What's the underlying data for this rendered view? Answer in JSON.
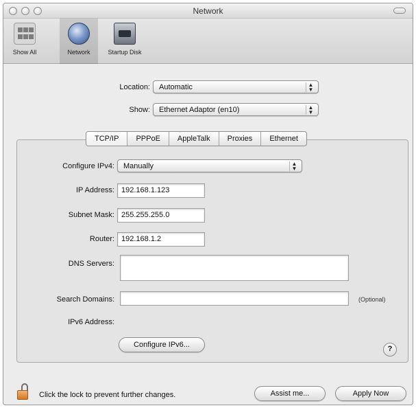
{
  "window": {
    "title": "Network"
  },
  "toolbar": {
    "items": [
      {
        "label": "Show All",
        "icon": "show-all-icon"
      },
      {
        "label": "Network",
        "icon": "network-globe-icon",
        "selected": true
      },
      {
        "label": "Startup Disk",
        "icon": "startup-disk-icon"
      }
    ]
  },
  "location": {
    "label": "Location:",
    "value": "Automatic"
  },
  "show": {
    "label": "Show:",
    "value": "Ethernet Adaptor (en10)"
  },
  "tabs": [
    {
      "label": "TCP/IP",
      "active": true
    },
    {
      "label": "PPPoE"
    },
    {
      "label": "AppleTalk"
    },
    {
      "label": "Proxies"
    },
    {
      "label": "Ethernet"
    }
  ],
  "tcpip": {
    "configure": {
      "label": "Configure IPv4:",
      "value": "Manually"
    },
    "ip_address": {
      "label": "IP Address:",
      "value": "192.168.1.123"
    },
    "subnet_mask": {
      "label": "Subnet Mask:",
      "value": "255.255.255.0"
    },
    "router": {
      "label": "Router:",
      "value": "192.168.1.2"
    },
    "dns_servers": {
      "label": "DNS Servers:",
      "value": ""
    },
    "search_domains": {
      "label": "Search Domains:",
      "value": "",
      "hint": "(Optional)"
    },
    "ipv6_address": {
      "label": "IPv6 Address:",
      "value": ""
    },
    "configure_ipv6_label": "Configure IPv6...",
    "help_label": "?"
  },
  "footer": {
    "lock_text": "Click the lock to prevent further changes.",
    "assist_label": "Assist me...",
    "apply_label": "Apply Now"
  },
  "colors": {
    "window_bg": "#ececec",
    "panel_bg": "#e4e4e4",
    "lock": "#d7781f"
  }
}
